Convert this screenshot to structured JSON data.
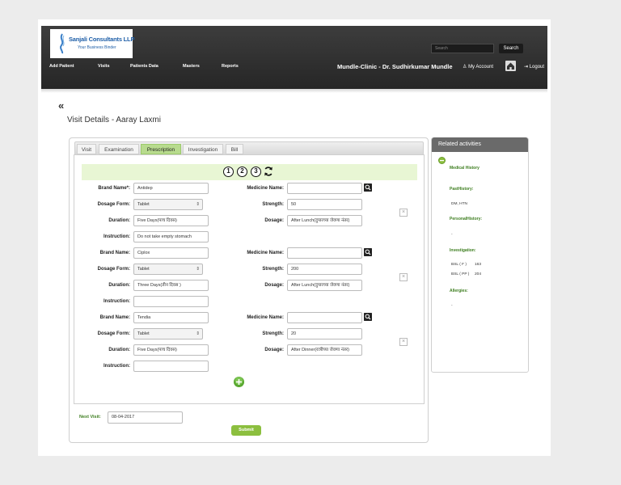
{
  "header": {
    "logo_name": "Sanjali Consultants LLP",
    "logo_tagline": "Your Business Binder",
    "search_placeholder": "Search",
    "search_button": "Search",
    "clinic_title": "Mundle-Clinic - Dr. Sudhirkumar Mundle",
    "my_account": "My Account",
    "logout": "Logout",
    "nav": [
      "Add Patient",
      "Visits",
      "Patients Data",
      "Masters",
      "Reports"
    ]
  },
  "page": {
    "back_icon": "double-chevron-left-icon",
    "title": "Visit Details - Aaray Laxmi"
  },
  "tabs": [
    {
      "label": "Visit",
      "active": false
    },
    {
      "label": "Examination",
      "active": false
    },
    {
      "label": "Prescription",
      "active": true
    },
    {
      "label": "Investigation",
      "active": false
    },
    {
      "label": "Bill",
      "active": false
    }
  ],
  "steps": [
    "1",
    "2",
    "3"
  ],
  "labels": {
    "brand_name_required": "Brand Name*:",
    "brand_name": "Brand Name:",
    "medicine_name": "Medicine Name:",
    "dosage_form": "Dosage Form:",
    "strength": "Strength:",
    "duration": "Duration:",
    "dosage": "Dosage:",
    "instruction": "Instruction:"
  },
  "prescriptions": [
    {
      "brand": "Antidep",
      "medicine": "",
      "dosage_form": "Tablet",
      "strength": "50",
      "duration": "Five Days(पाच दिवस)",
      "dosage": "After Lunch(दुपारच्या जेवणा नंतर)",
      "instruction": "Do not take empty stomach"
    },
    {
      "brand": "Ciplox",
      "medicine": "",
      "dosage_form": "Tablet",
      "strength": "200",
      "duration": "Three Days(तीन दिवस )",
      "dosage": "After Lunch(दुपारच्या जेवणा नंतर)",
      "instruction": ""
    },
    {
      "brand": "Tendia",
      "medicine": "",
      "dosage_form": "Tablet",
      "strength": "20",
      "duration": "Five Days(पाच दिवस)",
      "dosage": "After Dinner(रात्रीच्या जेवणा नंतर)",
      "instruction": ""
    }
  ],
  "footer": {
    "next_visit_label": "Next Visit:",
    "next_visit_value": "08-04-2017",
    "submit": "Submit"
  },
  "related": {
    "title": "Related activities",
    "medical_history": "Medical History",
    "past_history_label": "PastHistory:",
    "past_history_value": "DM, HTN",
    "personal_history_label": "PersonalHistory:",
    "personal_history_value": "-",
    "investigation_label": "Investigation:",
    "investigations": [
      {
        "name": "BSL ( F )",
        "value": "163"
      },
      {
        "name": "BSL ( PP )",
        "value": "204"
      }
    ],
    "allergies_label": "Allergies:",
    "allergies_value": "-"
  },
  "colors": {
    "header_bg": "#2e2e2e",
    "accent_green": "#8cbf3f",
    "active_tab": "#b8db8e",
    "steps_bar": "#e8f6d4"
  }
}
